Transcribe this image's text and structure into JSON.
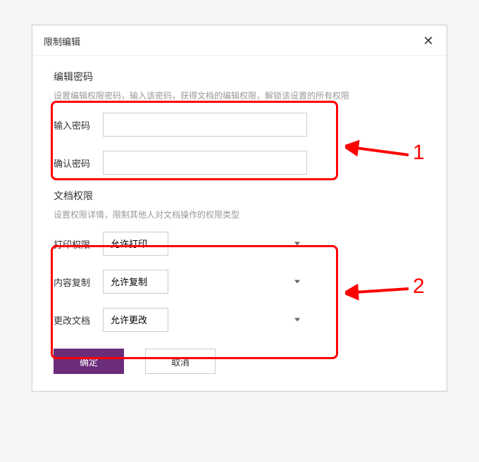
{
  "dialog": {
    "title": "限制编辑"
  },
  "section1": {
    "title": "编辑密码",
    "desc": "设置编辑权限密码，输入该密码，获得文档的编辑权限，解锁该设置的所有权限",
    "input_password_label": "输入密码",
    "confirm_password_label": "确认密码"
  },
  "section2": {
    "title": "文档权限",
    "desc": "设置权限详情，限制其他人对文档操作的权限类型",
    "print_label": "打印权限",
    "print_value": "允许打印",
    "copy_label": "内容复制",
    "copy_value": "允许复制",
    "modify_label": "更改文档",
    "modify_value": "允许更改"
  },
  "buttons": {
    "confirm": "确定",
    "cancel": "取消"
  },
  "annotations": {
    "label1": "1",
    "label2": "2"
  }
}
